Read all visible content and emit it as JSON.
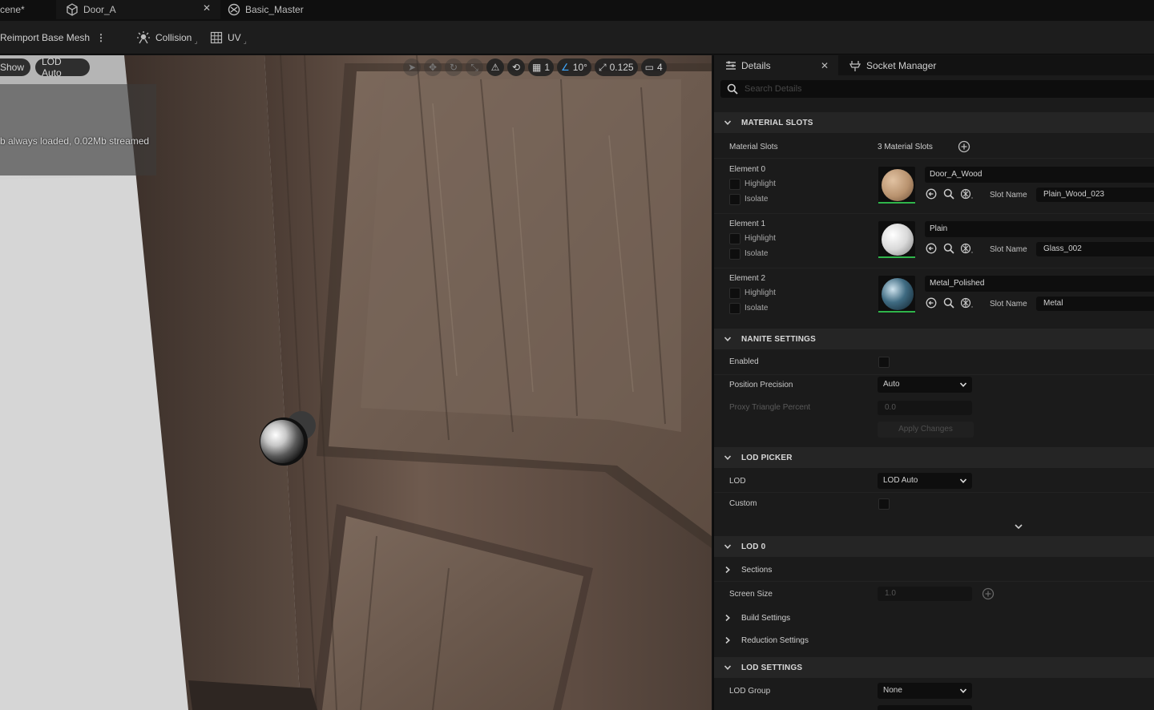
{
  "tabs": {
    "scene": "cene*",
    "door": "Door_A",
    "basic": "Basic_Master"
  },
  "toolbar": {
    "reimport": "Reimport Base Mesh",
    "collision": "Collision",
    "uv": "UV"
  },
  "viewport": {
    "show": "Show",
    "lod": "LOD Auto",
    "grid": "1",
    "rotation_snap": "10°",
    "scale_snap": "0.125",
    "camera_speed": "4",
    "stats": "b always loaded, 0.02Mb streamed"
  },
  "panel": {
    "details_tab": "Details",
    "socket_tab": "Socket Manager",
    "search_placeholder": "Search Details"
  },
  "material_slots": {
    "title": "MATERIAL SLOTS",
    "label": "Material Slots",
    "count": "3 Material Slots",
    "highlight": "Highlight",
    "isolate": "Isolate",
    "slot_name_label": "Slot Name",
    "elements": [
      {
        "label": "Element 0",
        "material": "Door_A_Wood",
        "slot": "Plain_Wood_023",
        "color": "#b8926e"
      },
      {
        "label": "Element 1",
        "material": "Plain",
        "slot": "Glass_002",
        "color": "#d9d9d9"
      },
      {
        "label": "Element 2",
        "material": "Metal_Polished",
        "slot": "Metal",
        "color": "#3f6b82"
      }
    ]
  },
  "nanite": {
    "title": "NANITE SETTINGS",
    "enabled": "Enabled",
    "position_precision": "Position Precision",
    "position_precision_value": "Auto",
    "proxy_triangle": "Proxy Triangle Percent",
    "proxy_value": "0.0",
    "apply": "Apply Changes"
  },
  "lod_picker": {
    "title": "LOD PICKER",
    "lod": "LOD",
    "lod_value": "LOD Auto",
    "custom": "Custom"
  },
  "lod0": {
    "title": "LOD 0",
    "sections": "Sections",
    "screen_size": "Screen Size",
    "screen_size_value": "1.0",
    "build_settings": "Build Settings",
    "reduction_settings": "Reduction Settings"
  },
  "lod_settings": {
    "title": "LOD SETTINGS",
    "lod_group": "LOD Group",
    "lod_group_value": "None"
  }
}
